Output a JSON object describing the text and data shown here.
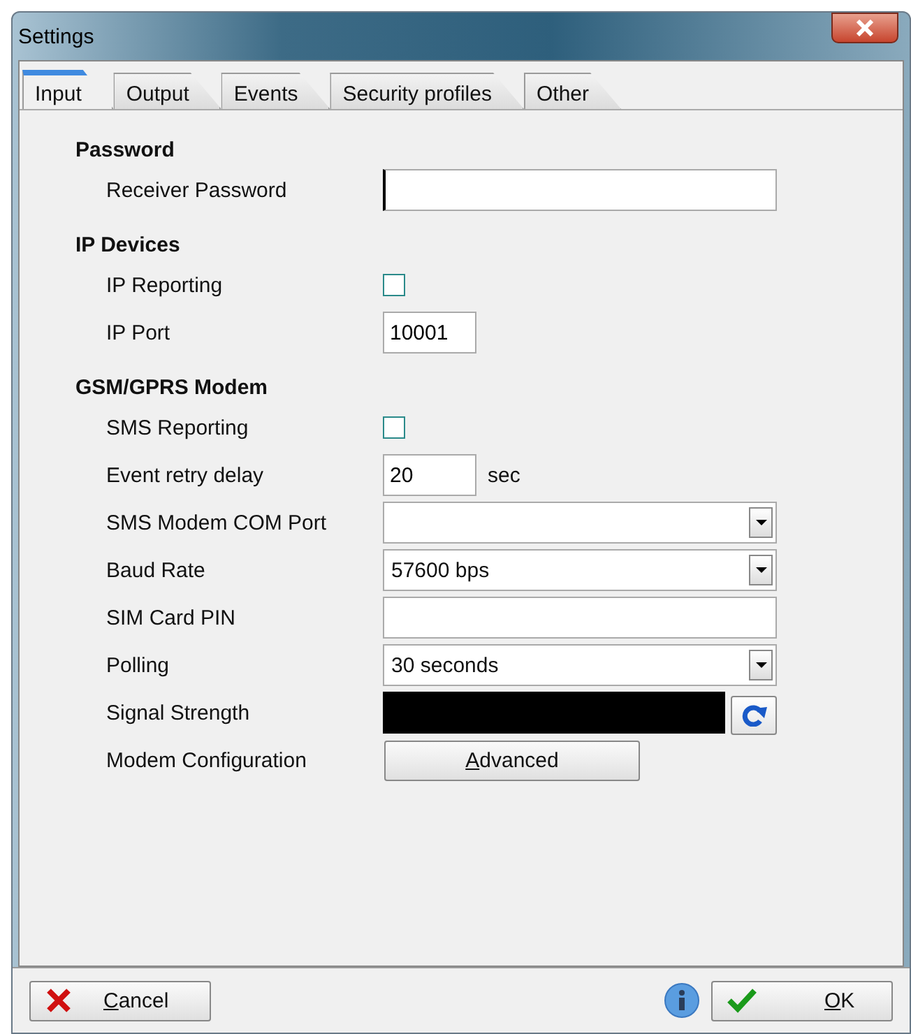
{
  "window": {
    "title": "Settings"
  },
  "tabs": [
    {
      "label": "Input",
      "selected": true
    },
    {
      "label": "Output",
      "selected": false
    },
    {
      "label": "Events",
      "selected": false
    },
    {
      "label": "Security profiles",
      "selected": false
    },
    {
      "label": "Other",
      "selected": false
    }
  ],
  "sections": [
    {
      "title": "Password",
      "rows": [
        {
          "kind": "text",
          "label": "Receiver Password",
          "value": "",
          "focused": true
        }
      ]
    },
    {
      "title": "IP Devices",
      "rows": [
        {
          "kind": "checkbox",
          "label": "IP Reporting",
          "checked": false
        },
        {
          "kind": "number",
          "label": "IP Port",
          "value": "10001",
          "focused": false
        }
      ]
    },
    {
      "title": "GSM/GPRS Modem",
      "rows": [
        {
          "kind": "checkbox",
          "label": "SMS Reporting",
          "checked": false
        },
        {
          "kind": "number",
          "label": "Event retry delay",
          "value": "20",
          "focused": false,
          "unit": "sec"
        },
        {
          "kind": "dropdown",
          "label": "SMS Modem COM Port",
          "value": ""
        },
        {
          "kind": "dropdown",
          "label": "Baud Rate",
          "value": "57600 bps"
        },
        {
          "kind": "text",
          "label": "SIM Card PIN",
          "value": "",
          "focused": false
        },
        {
          "kind": "dropdown",
          "label": "Polling",
          "value": "30 seconds"
        },
        {
          "kind": "meter",
          "label": "Signal Strength"
        },
        {
          "kind": "button",
          "label": "Modem Configuration",
          "button": "Advanced"
        }
      ]
    }
  ],
  "footer": {
    "cancel": "Cancel",
    "ok": "OK"
  }
}
